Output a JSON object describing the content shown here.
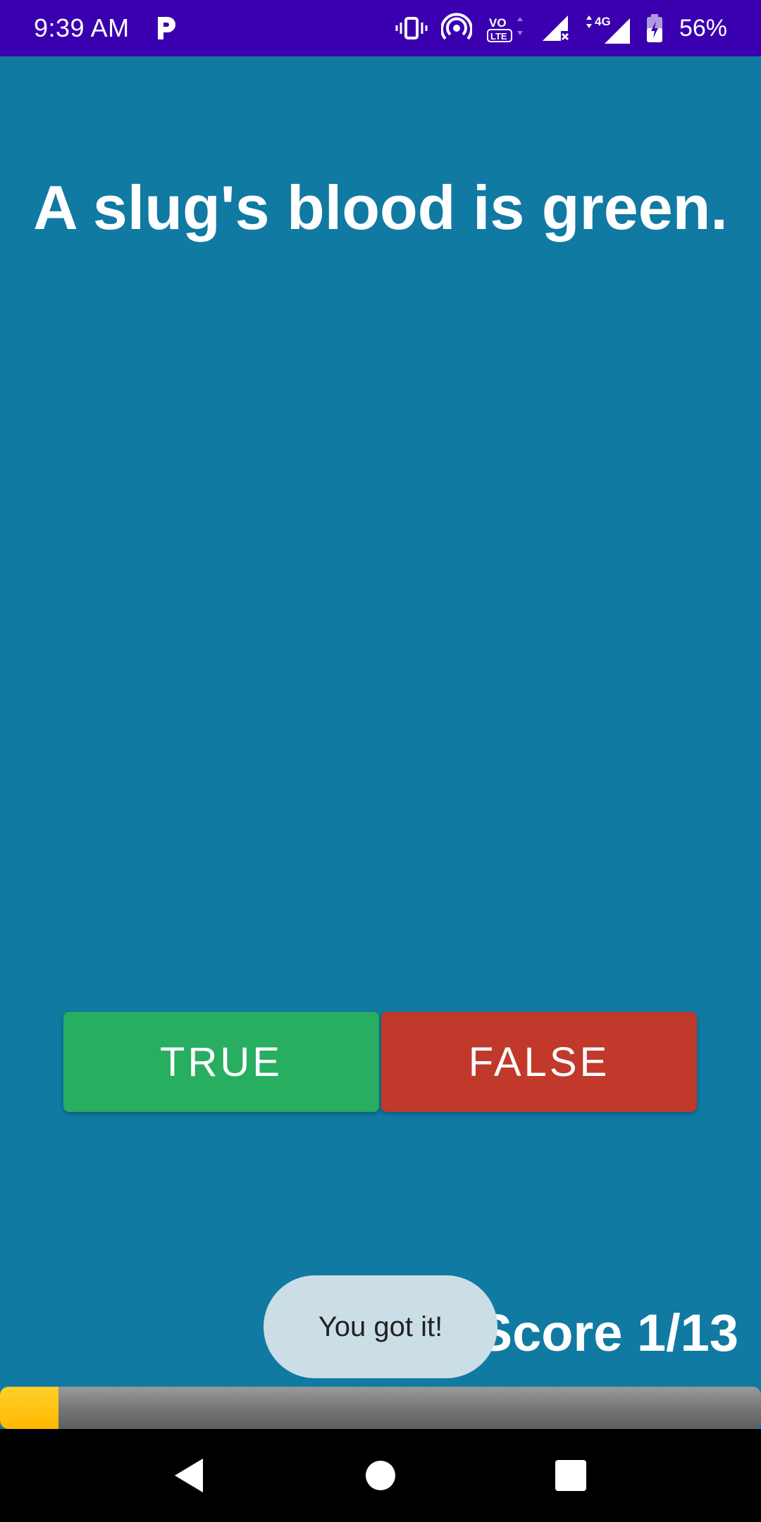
{
  "status_bar": {
    "time": "9:39 AM",
    "battery_percent": "56%",
    "network": "4G",
    "volte": "VoLTE",
    "icons": [
      "p-app-icon",
      "vibrate-icon",
      "hotspot-icon",
      "volte-icon",
      "signal-x-icon",
      "signal-4g-icon",
      "battery-charging-icon"
    ]
  },
  "question": {
    "text": "A slug's blood is green."
  },
  "answers": {
    "true_label": "TRUE",
    "false_label": "FALSE"
  },
  "toast": {
    "message": "You got it!"
  },
  "score": {
    "text": "Score 1/13"
  },
  "progress": {
    "value": 1,
    "max": 13
  },
  "colors": {
    "background": "#107aa3",
    "status_bar": "#3a00b0",
    "true_button": "#27ae60",
    "false_button": "#c0392b",
    "progress_fill": "#ffc107"
  },
  "nav_bar": {
    "icons": [
      "back-icon",
      "home-icon",
      "recents-icon"
    ]
  }
}
